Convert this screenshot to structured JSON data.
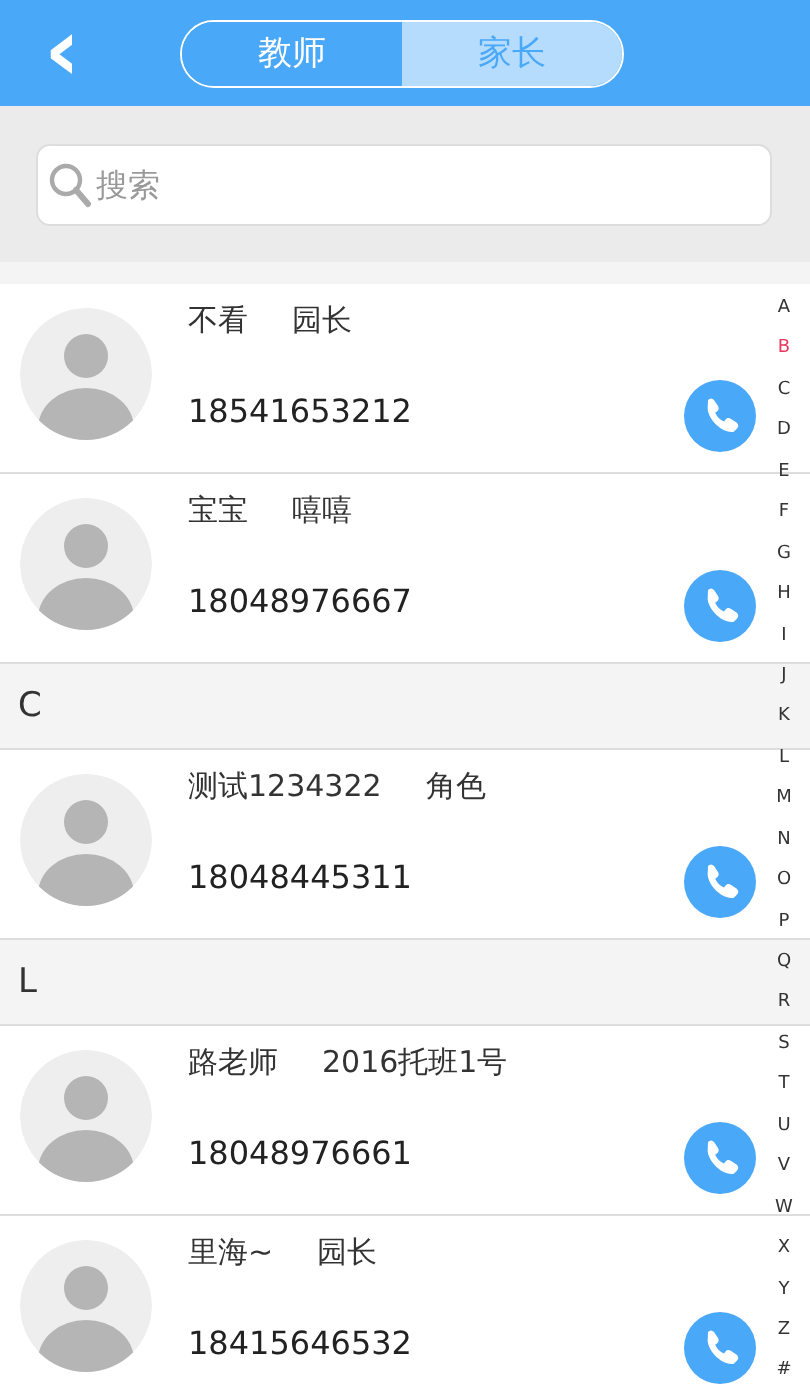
{
  "header": {
    "back": "‹",
    "tabs": [
      {
        "label": "教师",
        "selected": false
      },
      {
        "label": "家长",
        "selected": true
      }
    ]
  },
  "search": {
    "placeholder": "搜索"
  },
  "list": [
    {
      "kind": "contact",
      "name": "不看",
      "role": "园长",
      "phone": "18541653212"
    },
    {
      "kind": "contact",
      "name": "宝宝",
      "role": "嘻嘻",
      "phone": "18048976667"
    },
    {
      "kind": "header",
      "label": "C"
    },
    {
      "kind": "contact",
      "name": "测试1234322",
      "role": "角色",
      "phone": "18048445311"
    },
    {
      "kind": "header",
      "label": "L"
    },
    {
      "kind": "contact",
      "name": "路老师",
      "role": "2016托班1号",
      "phone": "18048976661"
    },
    {
      "kind": "contact",
      "name": "里海~",
      "role": "园长",
      "phone": "18415646532"
    }
  ],
  "index": [
    {
      "label": "A",
      "selected": false
    },
    {
      "label": "B",
      "selected": true
    },
    {
      "label": "C",
      "selected": false
    },
    {
      "label": "D",
      "selected": false
    },
    {
      "label": "E",
      "selected": false
    },
    {
      "label": "F",
      "selected": false
    },
    {
      "label": "G",
      "selected": false
    },
    {
      "label": "H",
      "selected": false
    },
    {
      "label": "I",
      "selected": false
    },
    {
      "label": "J",
      "selected": false
    },
    {
      "label": "K",
      "selected": false
    },
    {
      "label": "L",
      "selected": false
    },
    {
      "label": "M",
      "selected": false
    },
    {
      "label": "N",
      "selected": false
    },
    {
      "label": "O",
      "selected": false
    },
    {
      "label": "P",
      "selected": false
    },
    {
      "label": "Q",
      "selected": false
    },
    {
      "label": "R",
      "selected": false
    },
    {
      "label": "S",
      "selected": false
    },
    {
      "label": "T",
      "selected": false
    },
    {
      "label": "U",
      "selected": false
    },
    {
      "label": "V",
      "selected": false
    },
    {
      "label": "W",
      "selected": false
    },
    {
      "label": "X",
      "selected": false
    },
    {
      "label": "Y",
      "selected": false
    },
    {
      "label": "Z",
      "selected": false
    },
    {
      "label": "#",
      "selected": false
    }
  ]
}
